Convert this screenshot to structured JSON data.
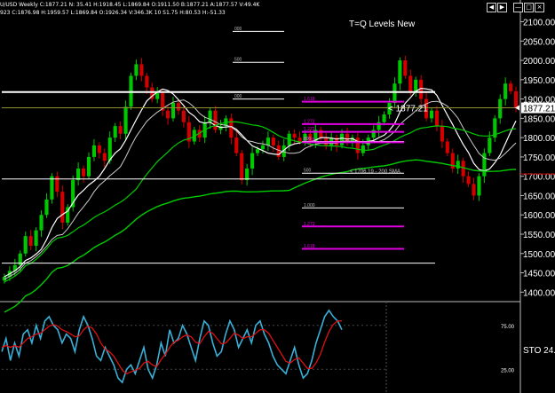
{
  "window": {
    "title": "U/USD Weekly C:1877.21 N: 35.41 H:1918.45 L:1869.84 O:1911.50 B:1877.21 A:1877.57 V:49.4K",
    "subtitle": "923 C:1876.98 H:1959.57 L:1869.84 O:1926.34 V:346.3K 10 S1.75 H:80.53 H:-51.33",
    "buttons": [
      "scroll-left",
      "scroll-right",
      "minimize",
      "maximize",
      "close"
    ]
  },
  "colors": {
    "background": "#000000",
    "up_candle": "#00c800",
    "down_candle": "#d40000",
    "white_line": "#ffffff",
    "fib_magenta": "#e000e0",
    "green_sma": "#00cc00",
    "olive_line": "#909030",
    "stoch_fast": "#3ab0d8",
    "stoch_slow": "#dd1111"
  },
  "chart_data": [
    {
      "type": "candlestick",
      "title": "T=Q Levels New",
      "xlabel": "",
      "ylabel": "",
      "ylim": [
        1380,
        2115
      ],
      "yticks": [
        "2100.00",
        "2050.00",
        "2000.00",
        "1950.00",
        "1900.00",
        "1850.00",
        "1800.00",
        "1750.00",
        "1700.00",
        "1650.00",
        "1600.00",
        "1550.00",
        "1500.00",
        "1450.00",
        "1400.00"
      ],
      "grid": false,
      "last_price": "1877.21",
      "last_price_label": "< 1877.21",
      "closes": [
        1440,
        1455,
        1470,
        1500,
        1545,
        1520,
        1560,
        1600,
        1640,
        1700,
        1660,
        1580,
        1620,
        1690,
        1720,
        1700,
        1750,
        1780,
        1760,
        1740,
        1800,
        1830,
        1810,
        1880,
        1960,
        1990,
        1960,
        1930,
        1900,
        1915,
        1870,
        1850,
        1890,
        1870,
        1840,
        1790,
        1820,
        1800,
        1840,
        1870,
        1820,
        1830,
        1850,
        1800,
        1760,
        1690,
        1720,
        1760,
        1770,
        1780,
        1800,
        1780,
        1750,
        1780,
        1810,
        1800,
        1790,
        1810,
        1790,
        1820,
        1800,
        1780,
        1800,
        1780,
        1810,
        1790,
        1800,
        1760,
        1780,
        1800,
        1820,
        1840,
        1860,
        1890,
        1940,
        2000,
        1960,
        1920,
        1950,
        1900,
        1850,
        1870,
        1830,
        1790,
        1760,
        1720,
        1740,
        1700,
        1680,
        1650,
        1700,
        1760,
        1800,
        1850,
        1900,
        1940,
        1920,
        1877.21
      ],
      "studies": [
        {
          "name": "200 SMA",
          "label": "< 1706.19 - 200 SMA",
          "color": "#00cc00"
        }
      ],
      "levels": [
        {
          "price": 2075,
          "label": "000",
          "color": "#ffffff"
        },
        {
          "price": 1995,
          "label": "500",
          "color": "#ffffff"
        },
        {
          "price": 1918,
          "label": "",
          "color": "#ffffff"
        },
        {
          "price": 1900,
          "label": "000",
          "color": "#ffffff"
        },
        {
          "price": 1893,
          "label": "1.618",
          "color": "#e000e0"
        },
        {
          "price": 1835,
          "label": "1.272",
          "color": "#e000e0"
        },
        {
          "price": 1815,
          "label": "1.272",
          "color": "#e000e0"
        },
        {
          "price": 1790,
          "label": "000",
          "color": "#ffffff"
        },
        {
          "price": 1788,
          "label": "1.618",
          "color": "#e000e0"
        },
        {
          "price": 1708,
          "label": "500",
          "color": "#ffffff"
        },
        {
          "price": 1693,
          "label": "",
          "color": "#ffffff"
        },
        {
          "price": 1618,
          "label": "1.000",
          "color": "#ffffff"
        },
        {
          "price": 1570,
          "label": "1.272",
          "color": "#e000e0"
        },
        {
          "price": 1512,
          "label": "1.618",
          "color": "#e000e0"
        },
        {
          "price": 1475,
          "label": "",
          "color": "#ffffff"
        }
      ]
    },
    {
      "type": "line",
      "title": "STO",
      "label": "STO 24.",
      "ylim": [
        0,
        100
      ],
      "yticks": [
        "25.00",
        "75.00"
      ],
      "series": [
        {
          "color": "#3ab0d8",
          "values": [
            45,
            60,
            35,
            55,
            40,
            65,
            70,
            55,
            75,
            60,
            80,
            85,
            75,
            70,
            55,
            65,
            60,
            45,
            70,
            85,
            75,
            60,
            40,
            35,
            50,
            40,
            30,
            15,
            10,
            25,
            30,
            20,
            35,
            50,
            25,
            15,
            30,
            55,
            40,
            70,
            55,
            60,
            75,
            65,
            50,
            35,
            60,
            80,
            75,
            55,
            40,
            45,
            65,
            80,
            70,
            50,
            60,
            70,
            55,
            75,
            80,
            65,
            55,
            40,
            30,
            25,
            20,
            35,
            50,
            30,
            15,
            20,
            35,
            55,
            70,
            85,
            92,
            85,
            80,
            70
          ]
        },
        {
          "color": "#dd1111",
          "values": [
            50,
            52,
            50,
            52,
            50,
            55,
            60,
            62,
            65,
            66,
            70,
            74,
            76,
            74,
            70,
            68,
            65,
            62,
            63,
            70,
            74,
            72,
            65,
            55,
            48,
            45,
            40,
            32,
            24,
            20,
            22,
            24,
            26,
            32,
            34,
            30,
            28,
            36,
            42,
            50,
            56,
            58,
            62,
            64,
            62,
            56,
            54,
            62,
            68,
            66,
            60,
            54,
            55,
            60,
            66,
            64,
            60,
            62,
            62,
            66,
            70,
            70,
            66,
            58,
            50,
            42,
            34,
            32,
            36,
            38,
            32,
            26,
            26,
            32,
            42,
            56,
            68,
            76,
            80,
            80
          ]
        }
      ]
    }
  ]
}
